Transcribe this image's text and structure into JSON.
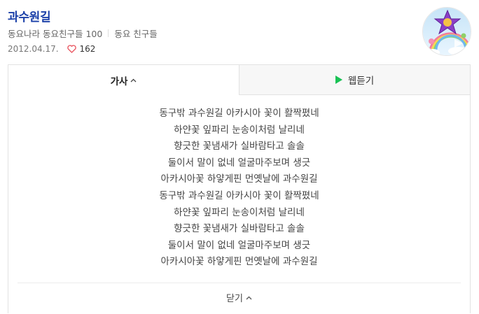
{
  "title": "과수원길",
  "meta": {
    "channel": "동요나라 동요친구들 100",
    "artist": "동요 친구들"
  },
  "stats": {
    "date": "2012.04.17.",
    "likes": "162"
  },
  "thumbnail": {
    "icon": "album-art-rainbow-star"
  },
  "tabs": [
    {
      "label": "가사",
      "active": true
    },
    {
      "label": "웹듣기",
      "active": false
    }
  ],
  "lyrics": [
    "동구밖 과수원길 아카시아 꽃이 활짝폈네",
    "하얀꽃 잎파리 눈송이처럼 날리네",
    "향긋한 꽃냄새가 실바람타고 솔솔",
    "둘이서 말이 없네 얼굴마주보며 생긋",
    "아카시아꽃 하얗게핀 먼옛날에 과수원길",
    "동구밖 과수원길 아카시아 꽃이 활짝폈네",
    "하얀꽃 잎파리 눈송이처럼 날리네",
    "향긋한 꽃냄새가 실바람타고 솔솔",
    "둘이서 말이 없네 얼굴마주보며 생긋",
    "아카시아꽃 하얗게핀 먼옛날에 과수원길"
  ],
  "close_label": "닫기",
  "colors": {
    "title": "#1a3fa8",
    "heart": "#e8505b",
    "play": "#19c254"
  }
}
